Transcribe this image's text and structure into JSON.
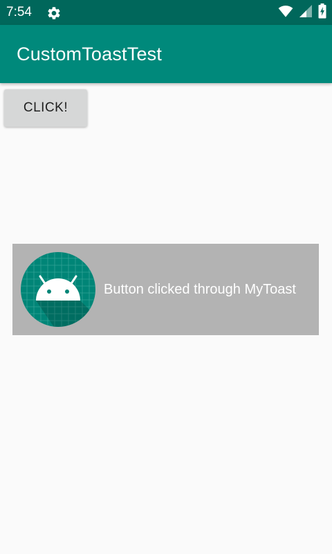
{
  "status_bar": {
    "time": "7:54",
    "icons": [
      "gear-icon",
      "wifi-icon",
      "cell-signal-icon",
      "battery-charging-icon"
    ],
    "background": "#00675b"
  },
  "app_bar": {
    "title": "CustomToastTest",
    "background": "#00897b"
  },
  "main": {
    "click_button_label": "CLICK!"
  },
  "toast": {
    "icon": "android-launcher-icon",
    "message": "Button clicked through MyToast",
    "background": "#b3b3b3"
  }
}
